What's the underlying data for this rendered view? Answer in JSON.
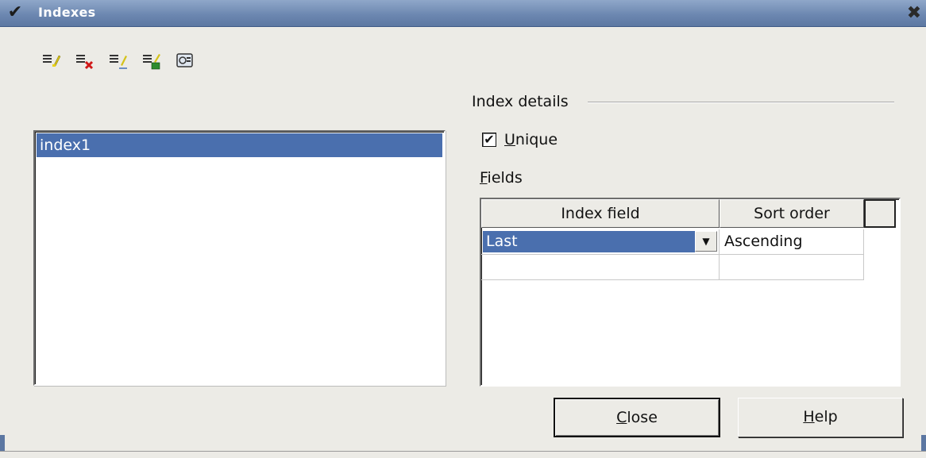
{
  "window": {
    "title": "Indexes",
    "menu_icon": "✔",
    "close_icon": "✖"
  },
  "toolbar": {
    "buttons": [
      {
        "icon": "new-index-icon"
      },
      {
        "icon": "delete-index-icon"
      },
      {
        "icon": "rename-index-icon"
      },
      {
        "icon": "save-index-icon"
      },
      {
        "icon": "reset-index-icon"
      }
    ]
  },
  "index_list": {
    "items": [
      "index1"
    ],
    "selected": "index1"
  },
  "details": {
    "section_label": "Index details",
    "unique": {
      "label_mnemonic": "U",
      "label_rest": "nique",
      "checked": true,
      "check_glyph": "✔"
    },
    "fields_label_mnemonic": "F",
    "fields_label_rest": "ields",
    "grid": {
      "columns": [
        "Index field",
        "Sort order"
      ],
      "rows": [
        {
          "field": "Last",
          "sort": "Ascending"
        },
        {
          "field": "",
          "sort": ""
        }
      ],
      "dropdown_arrow": "▼"
    }
  },
  "buttons": {
    "close_mnemonic": "C",
    "close_rest": "lose",
    "help_mnemonic": "H",
    "help_rest": "elp"
  }
}
